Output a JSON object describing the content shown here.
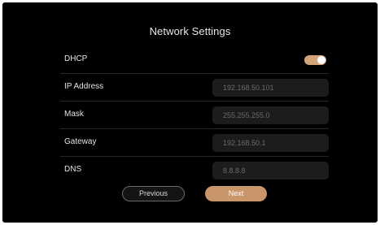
{
  "title": "Network Settings",
  "colors": {
    "accent": "#d5a37a",
    "background": "#000000",
    "field_background": "#1c1c1c"
  },
  "dhcp": {
    "label": "DHCP",
    "enabled": true
  },
  "fields": {
    "ip": {
      "label": "IP Address",
      "value": "192.168.50.101"
    },
    "mask": {
      "label": "Mask",
      "value": "255.255.255.0"
    },
    "gateway": {
      "label": "Gateway",
      "value": "192.168.50.1"
    },
    "dns": {
      "label": "DNS",
      "value": "8.8.8.8"
    }
  },
  "buttons": {
    "previous": "Previous",
    "next": "Next"
  }
}
